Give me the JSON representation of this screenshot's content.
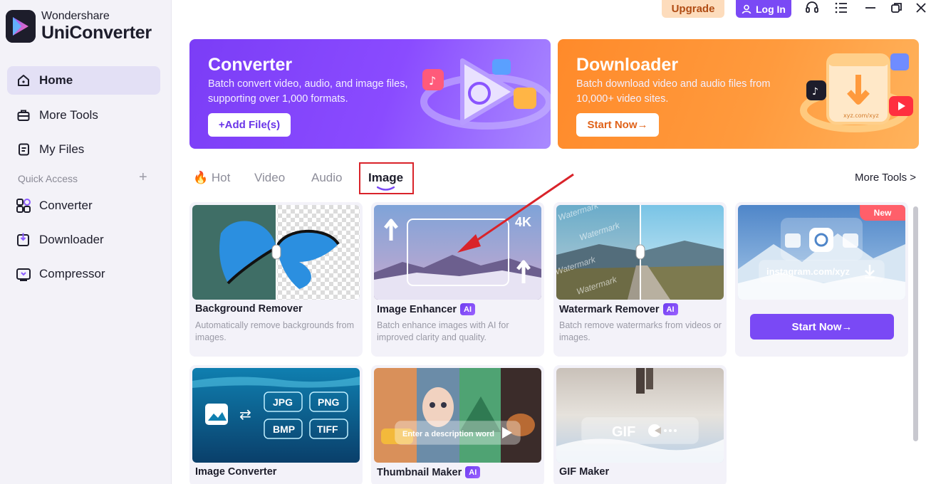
{
  "brand": {
    "top": "Wondershare",
    "main": "UniConverter"
  },
  "sidebar": {
    "items": [
      {
        "label": "Home",
        "icon": "home-icon",
        "active": true
      },
      {
        "label": "More Tools",
        "icon": "toolbox-icon"
      },
      {
        "label": "My Files",
        "icon": "file-icon"
      }
    ],
    "quick_access_label": "Quick Access",
    "quick_access_items": [
      {
        "label": "Converter",
        "icon": "converter-icon"
      },
      {
        "label": "Downloader",
        "icon": "downloader-icon"
      },
      {
        "label": "Compressor",
        "icon": "compressor-icon"
      }
    ]
  },
  "topbar": {
    "upgrade": "Upgrade",
    "login": "Log In"
  },
  "banners": {
    "converter": {
      "title": "Converter",
      "desc": "Batch convert video, audio, and image files, supporting over 1,000 formats.",
      "button": "+Add File(s)"
    },
    "downloader": {
      "title": "Downloader",
      "desc": "Batch download video and audio files from 10,000+ video sites.",
      "button": "Start Now→",
      "art_url_text": "xyz.com/xyz"
    }
  },
  "tabs": [
    {
      "label": "Hot",
      "icon": "fire-icon"
    },
    {
      "label": "Video"
    },
    {
      "label": "Audio"
    },
    {
      "label": "Image",
      "active": true
    }
  ],
  "more_tools_link": "More Tools >",
  "cards": [
    {
      "title": "Background Remover",
      "ai": false,
      "desc": "Automatically remove backgrounds from images."
    },
    {
      "title": "Image Enhancer",
      "ai": true,
      "desc": "Batch enhance images with AI for improved clarity and quality.",
      "thumb_label": "4K"
    },
    {
      "title": "Watermark Remover",
      "ai": true,
      "desc": "Batch remove watermarks from videos or images.",
      "thumb_label": "Watermark"
    },
    {
      "title": "Image Converter",
      "ai": false,
      "formats": [
        "JPG",
        "PNG",
        "BMP",
        "TIFF"
      ]
    },
    {
      "title": "Thumbnail Maker",
      "ai": true,
      "thumb_label": "Enter a description word"
    },
    {
      "title": "GIF Maker",
      "ai": false,
      "thumb_label": "GIF"
    }
  ],
  "promo_card": {
    "badge": "New",
    "url": "instagram.com/xyz",
    "button": "Start Now→"
  },
  "ai_label": "AI"
}
